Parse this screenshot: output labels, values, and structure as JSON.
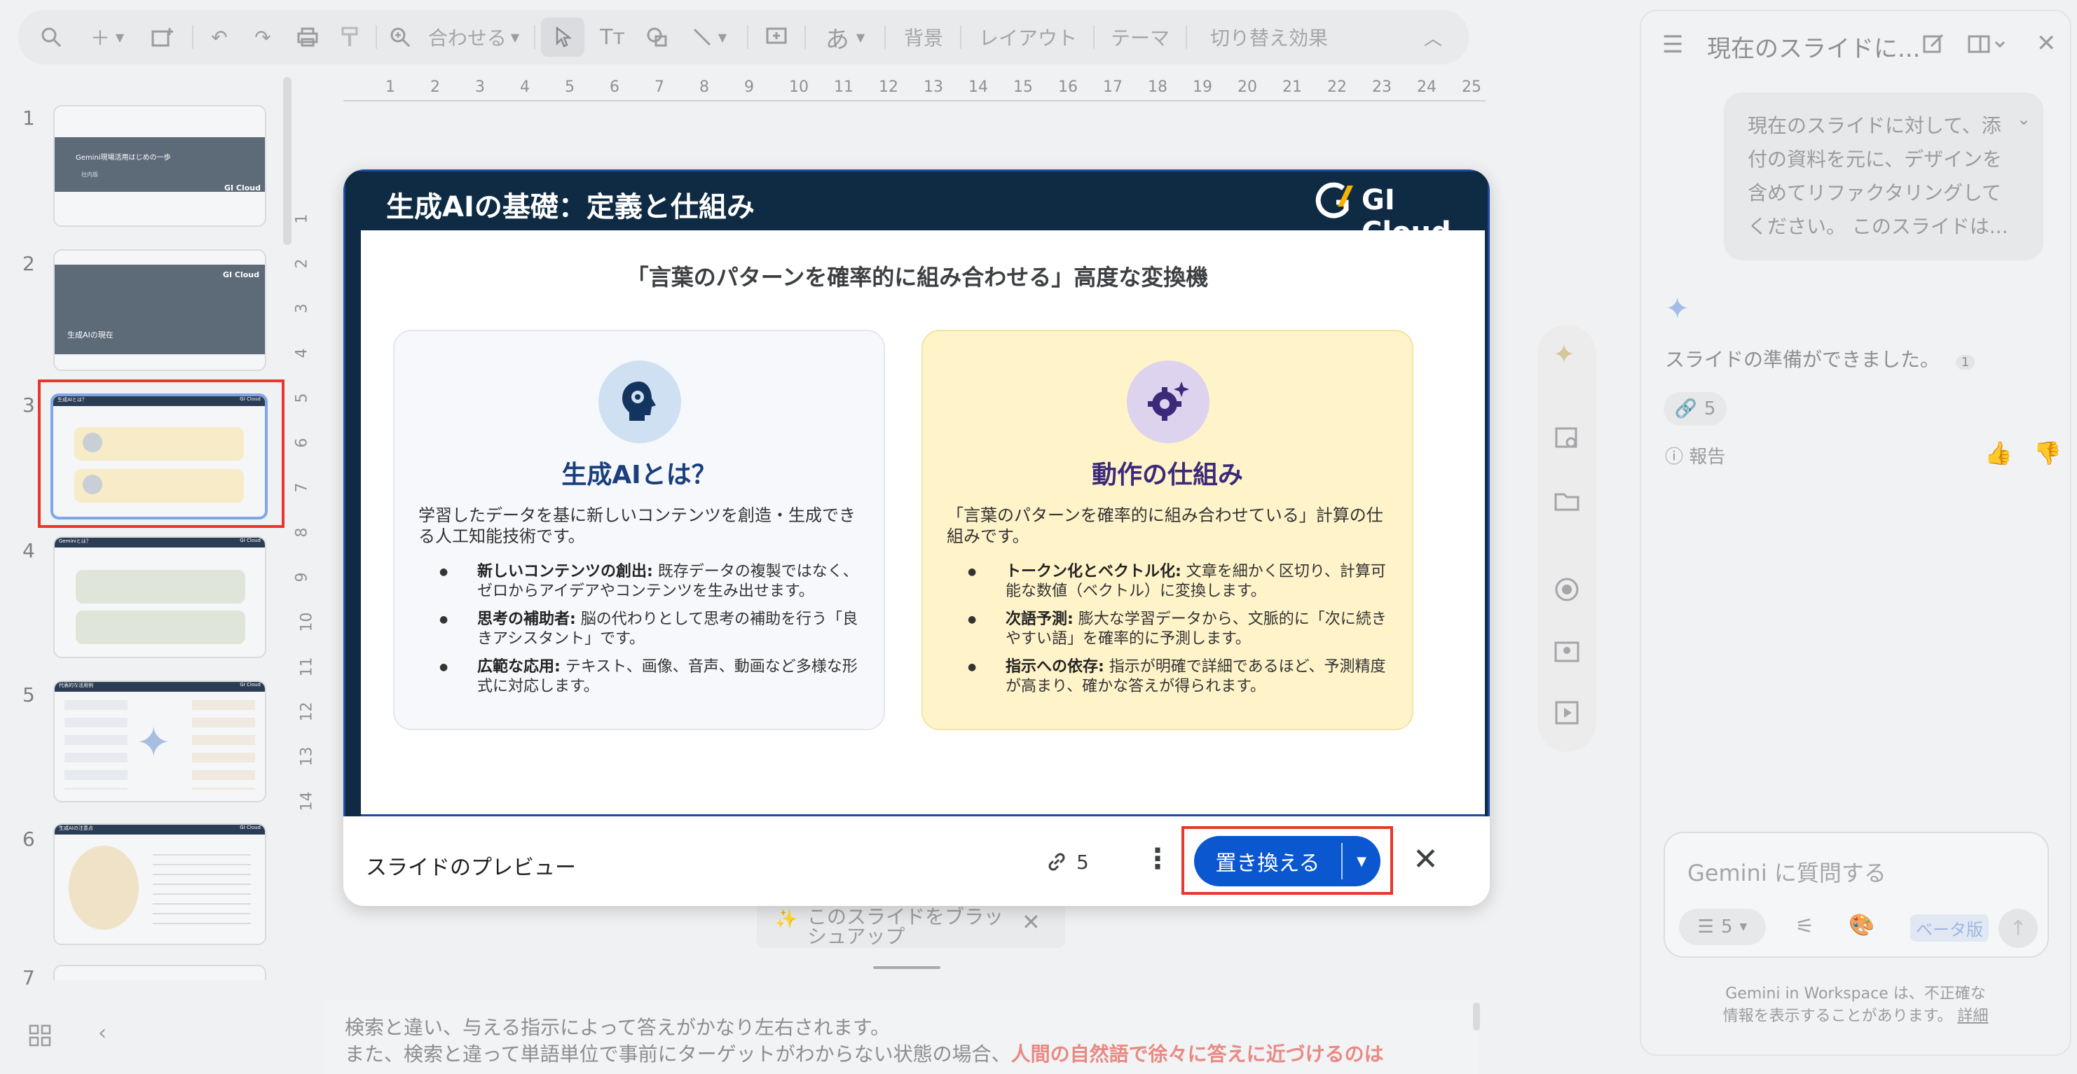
{
  "toolbar": {
    "zoom_label": "合わせる",
    "text_style_label": "あ",
    "background_label": "背景",
    "layout_label": "レイアウト",
    "theme_label": "テーマ",
    "transition_label": "切り替え効果"
  },
  "ruler": {
    "top": [
      "1",
      "2",
      "3",
      "4",
      "5",
      "6",
      "7",
      "8",
      "9",
      "10",
      "11",
      "12",
      "13",
      "14",
      "15",
      "16",
      "17",
      "18",
      "19",
      "20",
      "21",
      "22",
      "23",
      "24",
      "25"
    ],
    "left": [
      "1",
      "2",
      "3",
      "4",
      "5",
      "6",
      "7",
      "8",
      "9",
      "10",
      "11",
      "12",
      "13",
      "14"
    ]
  },
  "thumbnails": [
    {
      "num": "1",
      "title": "Gemini現場活用はじめの一歩",
      "sub": "社内版",
      "logo": "GI Cloud"
    },
    {
      "num": "2",
      "title": "生成AIの現在",
      "logo": "GI Cloud"
    },
    {
      "num": "3",
      "title": "生成AIとは？",
      "logo": "GI Cloud"
    },
    {
      "num": "4",
      "title": "Geminiとは？",
      "logo": "GI Cloud"
    },
    {
      "num": "5",
      "title": "代表的な活用例",
      "logo": "GI Cloud"
    },
    {
      "num": "6",
      "title": "生成AIの注意点",
      "logo": "GI Cloud"
    },
    {
      "num": "7"
    }
  ],
  "slide": {
    "title": "生成AIの基礎：定義と仕組み",
    "logo_text": "GI Cloud",
    "subtitle": "「言葉のパターンを確率的に組み合わせる」高度な変換機",
    "card_left": {
      "heading": "生成AIとは？",
      "intro": "学習したデータを基に新しいコンテンツを創造・生成できる人工知能技術です。",
      "bullets": [
        {
          "bold": "新しいコンテンツの創出:",
          "text": " 既存データの複製ではなく、ゼロからアイデアやコンテンツを生み出せます。"
        },
        {
          "bold": "思考の補助者:",
          "text": " 脳の代わりとして思考の補助を行う「良きアシスタント」です。"
        },
        {
          "bold": "広範な応用:",
          "text": " テキスト、画像、音声、動画など多様な形式に対応します。"
        }
      ]
    },
    "card_right": {
      "heading": "動作の仕組み",
      "intro": "「言葉のパターンを確率的に組み合わせている」計算の仕組みです。",
      "bullets": [
        {
          "bold": "トークン化とベクトル化:",
          "text": " 文章を細かく区切り、計算可能な数値（ベクトル）に変換します。"
        },
        {
          "bold": "次語予測:",
          "text": " 膨大な学習データから、文脈的に「次に続きやすい語」を確率的に予測します。"
        },
        {
          "bold": "指示への依存:",
          "text": " 指示が明確で詳細であるほど、予測精度が高まり、確かな答えが得られます。"
        }
      ]
    }
  },
  "dialog": {
    "preview_label": "スライドのプレビュー",
    "source_count": "5",
    "replace_label": "置き換える"
  },
  "background_snippet": {
    "suggestion_text_line1": "このスライドをブラッ",
    "suggestion_text_line2": "シュアップ"
  },
  "notes": {
    "line1": "検索と違い、与える指示によって答えがかなり左右されます。",
    "line2_plain": "また、検索と違って単語単位で事前にターゲットがわからない状態の場合、",
    "line2_highlight": "人間の自然語で徐々に答えに近づけるのは"
  },
  "gemini_panel": {
    "title": "現在のスライドに...",
    "user_message": "現在のスライドに対して、添付の資料を元に、デザインを含めてリファクタリングしてください。 このスライドは...",
    "response": "スライドの準備ができました。",
    "footnote": "1",
    "source_count": "5",
    "report_label": "報告",
    "input_placeholder": "Gemini に質問する",
    "attachments_count": "5",
    "beta_label": "ベータ版",
    "disclaimer_line1": "Gemini in Workspace は、不正確な",
    "disclaimer_line2": "情報を表示することがあります。",
    "details_link": "詳細"
  },
  "colors": {
    "slide_header": "#0f2b44",
    "accent_blue": "#0b57d0",
    "highlight_red": "#e8372c",
    "left_card_bg": "#f6f8fb",
    "right_card_bg": "#fff3c9",
    "right_heading": "#3b2a7a",
    "left_heading": "#1a3f7d"
  }
}
